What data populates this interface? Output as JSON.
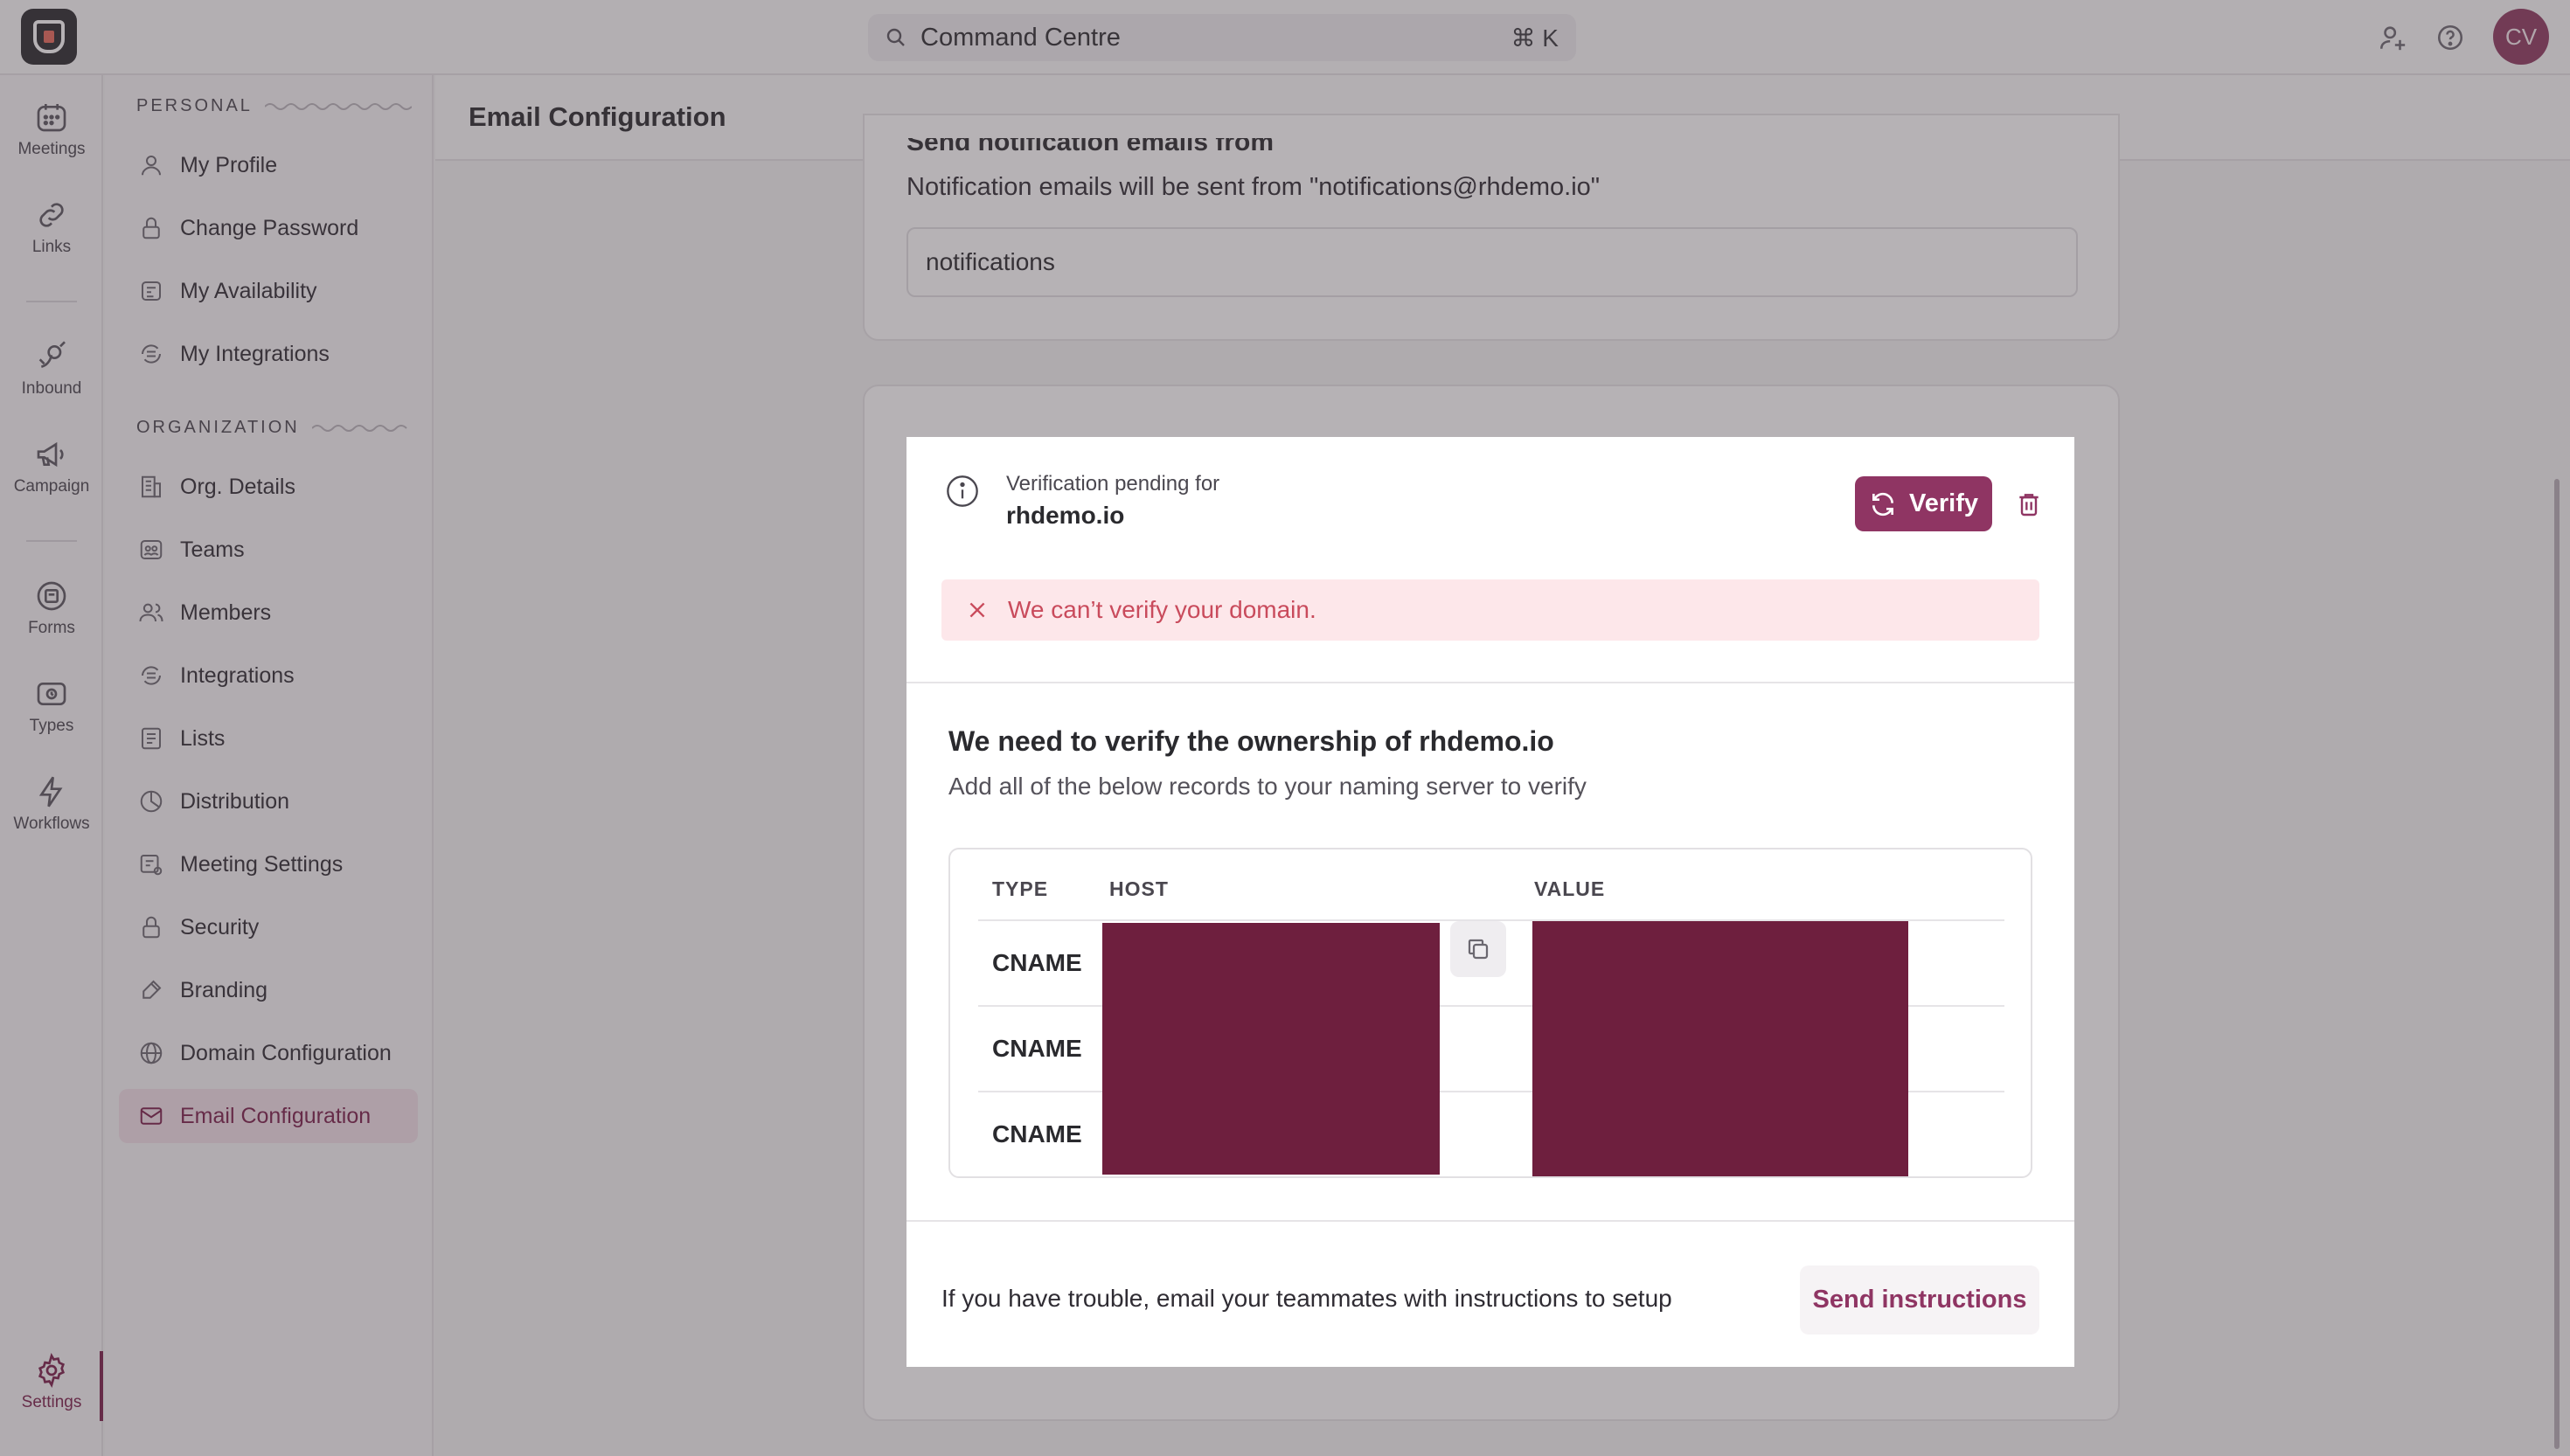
{
  "topbar": {
    "search_placeholder": "Command Centre",
    "search_shortcut": "⌘ K",
    "avatar_initials": "CV"
  },
  "rail": {
    "items": [
      {
        "label": "Meetings",
        "icon": "calendar-icon"
      },
      {
        "label": "Links",
        "icon": "link-icon"
      },
      {
        "label": "Inbound",
        "icon": "inbound-icon"
      },
      {
        "label": "Campaign",
        "icon": "megaphone-icon"
      },
      {
        "label": "Forms",
        "icon": "forms-icon"
      },
      {
        "label": "Types",
        "icon": "types-icon"
      },
      {
        "label": "Workflows",
        "icon": "lightning-icon"
      },
      {
        "label": "Settings",
        "icon": "gear-icon"
      }
    ]
  },
  "sidebar": {
    "personal_heading": "PERSONAL",
    "organization_heading": "ORGANIZATION",
    "personal": [
      {
        "label": "My Profile"
      },
      {
        "label": "Change Password"
      },
      {
        "label": "My Availability"
      },
      {
        "label": "My Integrations"
      }
    ],
    "organization": [
      {
        "label": "Org. Details"
      },
      {
        "label": "Teams"
      },
      {
        "label": "Members"
      },
      {
        "label": "Integrations"
      },
      {
        "label": "Lists"
      },
      {
        "label": "Distribution"
      },
      {
        "label": "Meeting Settings"
      },
      {
        "label": "Security"
      },
      {
        "label": "Branding"
      },
      {
        "label": "Domain Configuration"
      },
      {
        "label": "Email Configuration"
      }
    ],
    "active": "Email Configuration"
  },
  "main": {
    "title": "Email Configuration",
    "send_from": {
      "heading": "Send notification emails from",
      "description": "Notification emails will be sent from \"notifications@rhdemo.io\"",
      "value": "notifications"
    }
  },
  "modal": {
    "pending_label": "Verification pending for",
    "domain": "rhdemo.io",
    "verify_label": "Verify",
    "error": "We can’t verify your domain.",
    "heading": "We need to verify the ownership of rhdemo.io",
    "subheading": "Add all of the below records to your naming server to verify",
    "table": {
      "columns": [
        "TYPE",
        "HOST",
        "VALUE"
      ],
      "rows": [
        {
          "type": "CNAME"
        },
        {
          "type": "CNAME"
        },
        {
          "type": "CNAME"
        }
      ]
    },
    "footer_text": "If you have trouble, email your teammates with instructions to setup",
    "send_label": "Send instructions"
  },
  "colors": {
    "brand": "#8f3563",
    "redaction": "#6e1f3e",
    "error": "#c94b5c",
    "error_bg": "#fde7ea"
  }
}
